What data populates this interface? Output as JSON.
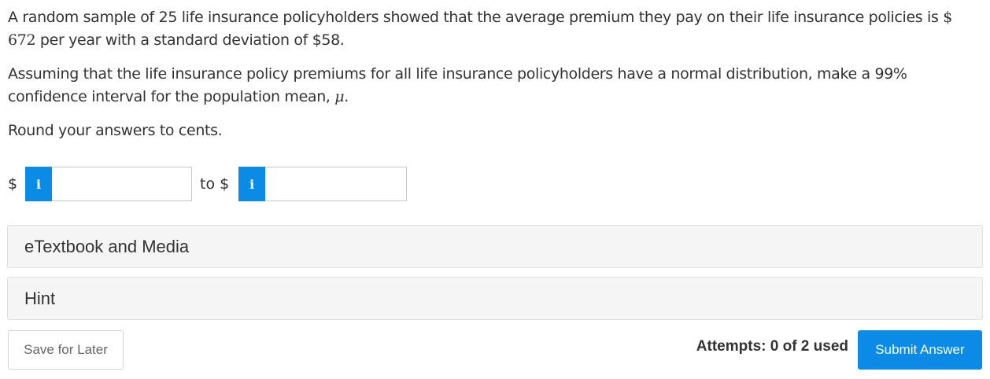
{
  "question": {
    "p1_before": "A random sample of 25 life insurance policyholders showed that the average premium they pay on their life insurance policies is ",
    "p1_amount": "$ 672",
    "p1_after": " per year with a standard deviation of $58.",
    "p2_before": "Assuming that the life insurance policy premiums for all life insurance policyholders have a normal distribution, make a 99% confidence interval for the population mean, ",
    "p2_symbol": "μ",
    "p2_after": ".",
    "p3": "Round your answers to cents."
  },
  "answer": {
    "currency_left": "$",
    "info_icon": "i",
    "lower_value": "",
    "to_label": "to $",
    "upper_value": ""
  },
  "panels": {
    "etextbook": "eTextbook and Media",
    "hint": "Hint"
  },
  "footer": {
    "save_label": "Save for Later",
    "attempts": "Attempts: 0 of 2 used",
    "submit_label": "Submit Answer"
  },
  "colors": {
    "accent": "#0b8ae6",
    "panel_bg": "#f5f5f5",
    "text": "#333333"
  }
}
